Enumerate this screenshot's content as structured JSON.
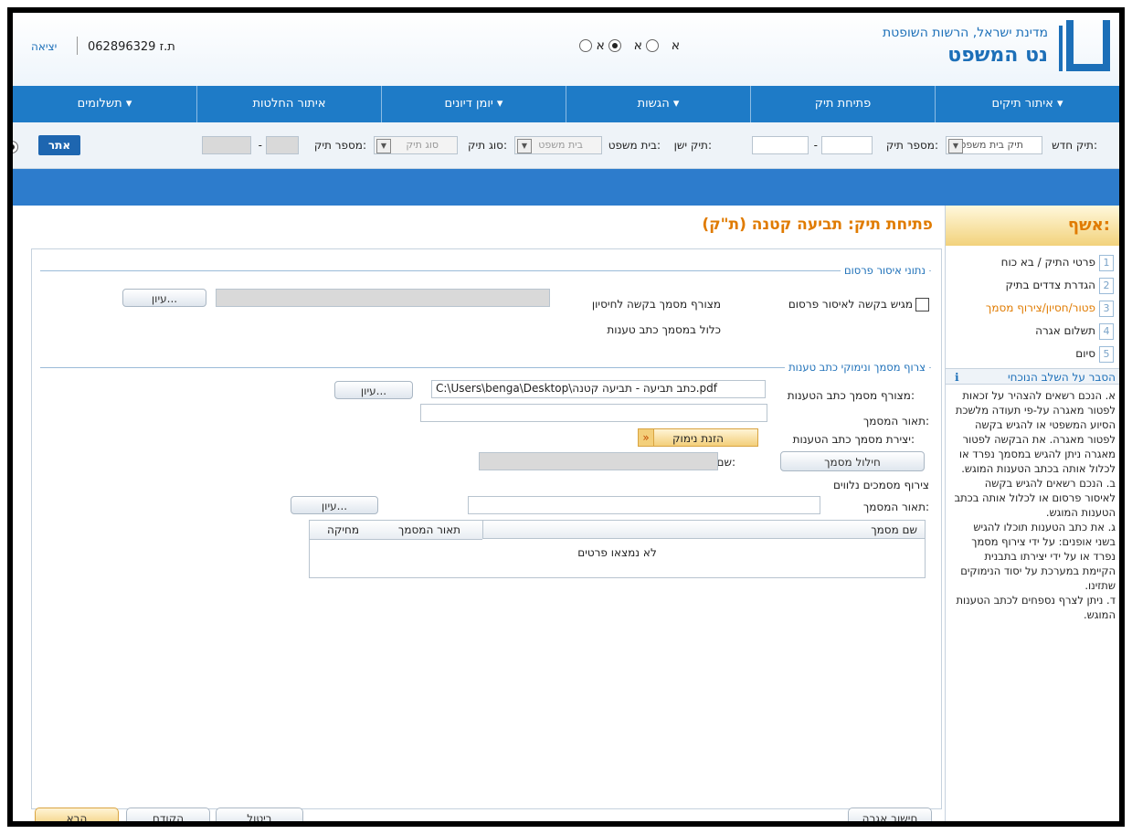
{
  "header": {
    "state_name": "מדינת ישראל, הרשות השופטת",
    "app_name": "נט המשפט",
    "lang_options": [
      "א",
      "א",
      "א"
    ],
    "lang_selected_index": 0,
    "id_label": "ת.ז 062896329",
    "exit_label": "יציאה"
  },
  "nav": {
    "items": [
      "איתור תיקים",
      "פתיחת תיק",
      "הגשות",
      "יומן דיונים",
      "איתור החלטות",
      "תשלומים"
    ],
    "dropdown": [
      true,
      false,
      true,
      true,
      false,
      true
    ],
    "chevron": "▾"
  },
  "search": {
    "new_case_label": "תיק חדש:",
    "new_case_select": "תיק בית משפט",
    "case_number_label": "מספר תיק:",
    "old_case_label": "תיק ישן:",
    "court_label": "בית משפט:",
    "court_select": "בית משפט",
    "case_type_label": "סוג תיק:",
    "case_type_select": "סוג תיק",
    "case_number_label_2": "מספר תיק:",
    "search_button": "אתר",
    "dash": "-"
  },
  "sidebar": {
    "title": "אשף:",
    "steps": [
      {
        "num": "1",
        "label": "פרטי התיק / בא כוח"
      },
      {
        "num": "2",
        "label": "הגדרת צדדים בתיק"
      },
      {
        "num": "3",
        "label": "פטור/חסיון/צירוף מסמך"
      },
      {
        "num": "4",
        "label": "תשלום אגרה"
      },
      {
        "num": "5",
        "label": "סיום"
      }
    ],
    "active_step": 3,
    "help_title": "הסבר על השלב הנוכחי",
    "help_text": [
      "א. הנכם רשאים להצהיר על זכאות לפטור מאגרה על-פי תעודה מלשכת הסיוע המשפטי או להגיש בקשה לפטור מאגרה. את הבקשה לפטור מאגרה ניתן להגיש במסמך נפרד או לכלול אותה בכתב הטענות המוגש.",
      "ב. הנכם רשאים להגיש בקשה לאיסור פרסום או לכלול אותה בכתב הטענות המוגש.",
      "ג. את כתב הטענות תוכלו להגיש בשני אופנים: על ידי צירוף מסמך נפרד או על ידי יצירתו בתבנית הקיימת במערכת על יסוד הנימוקים שתזינו.",
      "ד. ניתן לצרף נספחים לכתב הטענות המוגש."
    ]
  },
  "main": {
    "title": "פתיחת תיק: תביעה קטנה (ת\"ק)",
    "publication": {
      "legend": "נתוני איסור פרסום",
      "request_checkbox": "מגיש בקשה לאיסור פרסום",
      "attach_option": "מצורף מסמך בקשה לחיסיון",
      "include_option": "כלול במסמך כתב טענות",
      "browse_button": "עיון..."
    },
    "pleading": {
      "legend": "צרוף מסמך ונימוקי כתב טענות",
      "attached_label": "מצורף מסמך כתב הטענות:",
      "file_path": "C:\\Users\\benga\\Desktop\\כתב תביעה - תביעה קטנה.pdf",
      "browse_button": "עיון...",
      "doc_desc_label": "תאור המסמך:",
      "create_label": "יצירת מסמך כתב הטענות:",
      "reasons_button": "הזנת נימוק",
      "reasons_chevron": "»",
      "generate_button": "חילול מסמך",
      "submitter_label": "שם המגיש:"
    },
    "attachments": {
      "title": "צירוף מסמכים נלווים",
      "doc_desc_label": "תאור המסמך:",
      "browse_button": "עיון...",
      "columns": [
        "שם מסמך",
        "תאור המסמך",
        "מחיקה"
      ],
      "empty_message": "לא נמצאו פרטים"
    }
  },
  "footer": {
    "fee_button": "חישוב אגרה",
    "cancel_button": "ביטול",
    "back_button": "הקודם",
    "next_button": "הבא"
  },
  "colors": {
    "brand_blue": "#1e7bc7",
    "accent_orange": "#e07b00"
  }
}
